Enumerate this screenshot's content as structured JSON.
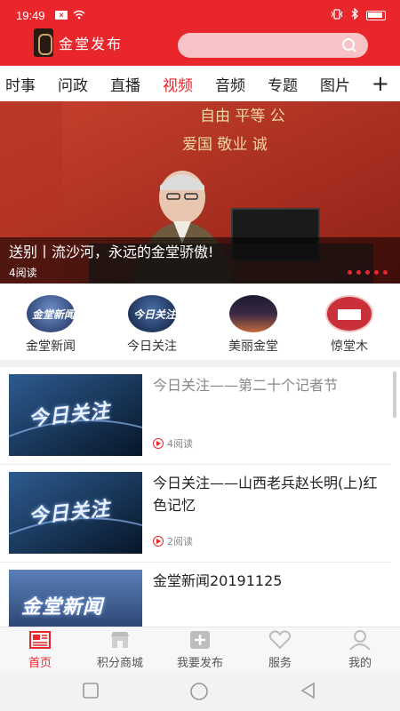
{
  "status": {
    "time": "19:49",
    "notif": "×"
  },
  "brand": {
    "name": "金堂发布"
  },
  "tabs": [
    {
      "label": "时事"
    },
    {
      "label": "问政"
    },
    {
      "label": "直播"
    },
    {
      "label": "视频",
      "active": true
    },
    {
      "label": "音频"
    },
    {
      "label": "专题"
    },
    {
      "label": "图片"
    }
  ],
  "tab_more": "+",
  "banner": {
    "title": "送别丨流沙河，永远的金堂骄傲!",
    "reads": "4阅读",
    "bg_text_1": "自由 平等 公",
    "bg_text_2": "爱国 敬业 诚"
  },
  "channels": [
    {
      "label": "金堂新闻"
    },
    {
      "label": "今日关注"
    },
    {
      "label": "美丽金堂"
    },
    {
      "label": "惊堂木"
    }
  ],
  "thumb_labels": {
    "jrgz": "今日关注",
    "jtxw": "金堂新闻"
  },
  "news": [
    {
      "title": "今日关注——第二十个记者节",
      "reads": "4阅读"
    },
    {
      "title": "今日关注——山西老兵赵长明(上)红色记忆",
      "reads": "2阅读"
    },
    {
      "title": "金堂新闻20191125"
    }
  ],
  "bottom_tabs": [
    {
      "label": "首页",
      "active": true
    },
    {
      "label": "积分商城"
    },
    {
      "label": "我要发布"
    },
    {
      "label": "服务"
    },
    {
      "label": "我的"
    }
  ],
  "colors": {
    "brand": "#e8262c"
  }
}
